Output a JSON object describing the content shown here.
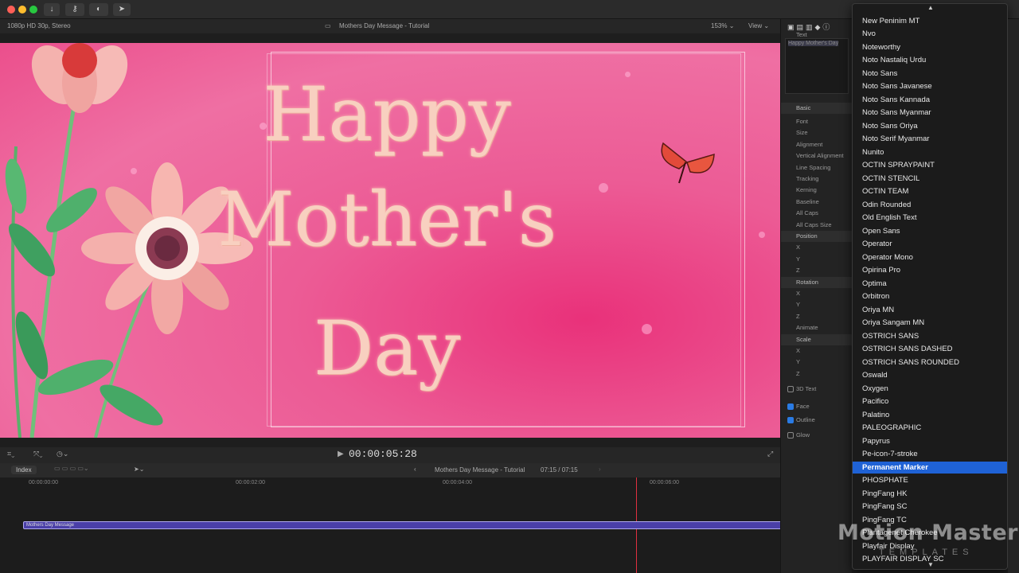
{
  "toolbar": {
    "colors": {
      "close": "#ff5f57",
      "minimize": "#febc2e",
      "zoom": "#28c840"
    }
  },
  "viewer": {
    "format_info": "1080p HD 30p, Stereo",
    "project_name": "Mothers Day Message - Tutorial",
    "zoom": "153%",
    "view_label": "View",
    "timecode": "00:00:05:28",
    "title_lines": [
      "Happy",
      "Mother's",
      "Day"
    ]
  },
  "timeline": {
    "index_label": "Index",
    "project_name": "Mothers Day Message - Tutorial",
    "duration": "07:15 / 07:15",
    "ruler": [
      "00:00:00:00",
      "00:00:02:00",
      "00:00:04:00",
      "00:00:06:00"
    ],
    "clip_name": "Mothers Day Message"
  },
  "inspector": {
    "text_label": "Text",
    "text_value": "Happy Mother's Day",
    "rows": [
      {
        "label": "Basic",
        "section": true
      },
      {
        "label": "Font"
      },
      {
        "label": "Size"
      },
      {
        "label": "Alignment"
      },
      {
        "label": "Vertical Alignment"
      },
      {
        "label": "Line Spacing"
      },
      {
        "label": "Tracking"
      },
      {
        "label": "Kerning"
      },
      {
        "label": "Baseline"
      },
      {
        "label": "All Caps"
      },
      {
        "label": "All Caps Size"
      },
      {
        "label": "Position",
        "section": true
      },
      {
        "label": "X"
      },
      {
        "label": "Y"
      },
      {
        "label": "Z"
      },
      {
        "label": "Rotation",
        "section": true
      },
      {
        "label": "X"
      },
      {
        "label": "Y"
      },
      {
        "label": "Z"
      },
      {
        "label": "Animate"
      },
      {
        "label": "Scale",
        "section": true
      },
      {
        "label": "X"
      },
      {
        "label": "Y"
      },
      {
        "label": "Z"
      }
    ],
    "checks": [
      {
        "label": "3D Text",
        "checked": false
      },
      {
        "label": "Face",
        "checked": true
      },
      {
        "label": "Outline",
        "checked": true
      },
      {
        "label": "Glow",
        "checked": false
      }
    ]
  },
  "font_menu": {
    "selected": "Permanent Marker",
    "items": [
      "New Peninim MT",
      "Nvo",
      "Noteworthy",
      "Noto Nastaliq Urdu",
      "Noto Sans",
      "Noto Sans Javanese",
      "Noto Sans Kannada",
      "Noto Sans Myanmar",
      "Noto Sans Oriya",
      "Noto Serif Myanmar",
      "Nunito",
      "OCTIN SPRAYPAINT",
      "OCTIN STENCIL",
      "OCTIN TEAM",
      "Odin Rounded",
      "Old English Text",
      "Open Sans",
      "Operator",
      "Operator Mono",
      "Opirina Pro",
      "Optima",
      "Orbitron",
      "Oriya MN",
      "Oriya Sangam MN",
      "OSTRICH SANS",
      "OSTRICH SANS DASHED",
      "OSTRICH SANS ROUNDED",
      "Oswald",
      "Oxygen",
      "Pacifico",
      "Palatino",
      "PALEOGRAPHIC",
      "Papyrus",
      "Pe-icon-7-stroke",
      "Permanent Marker",
      "PHOSPHATE",
      "PingFang HK",
      "PingFang SC",
      "PingFang TC",
      "Plantagenet Cherokee",
      "Playfair Display",
      "PLAYFAIR DISPLAY SC"
    ]
  },
  "watermark": {
    "title": "Motion Master",
    "subtitle": "TEMPLATES"
  }
}
